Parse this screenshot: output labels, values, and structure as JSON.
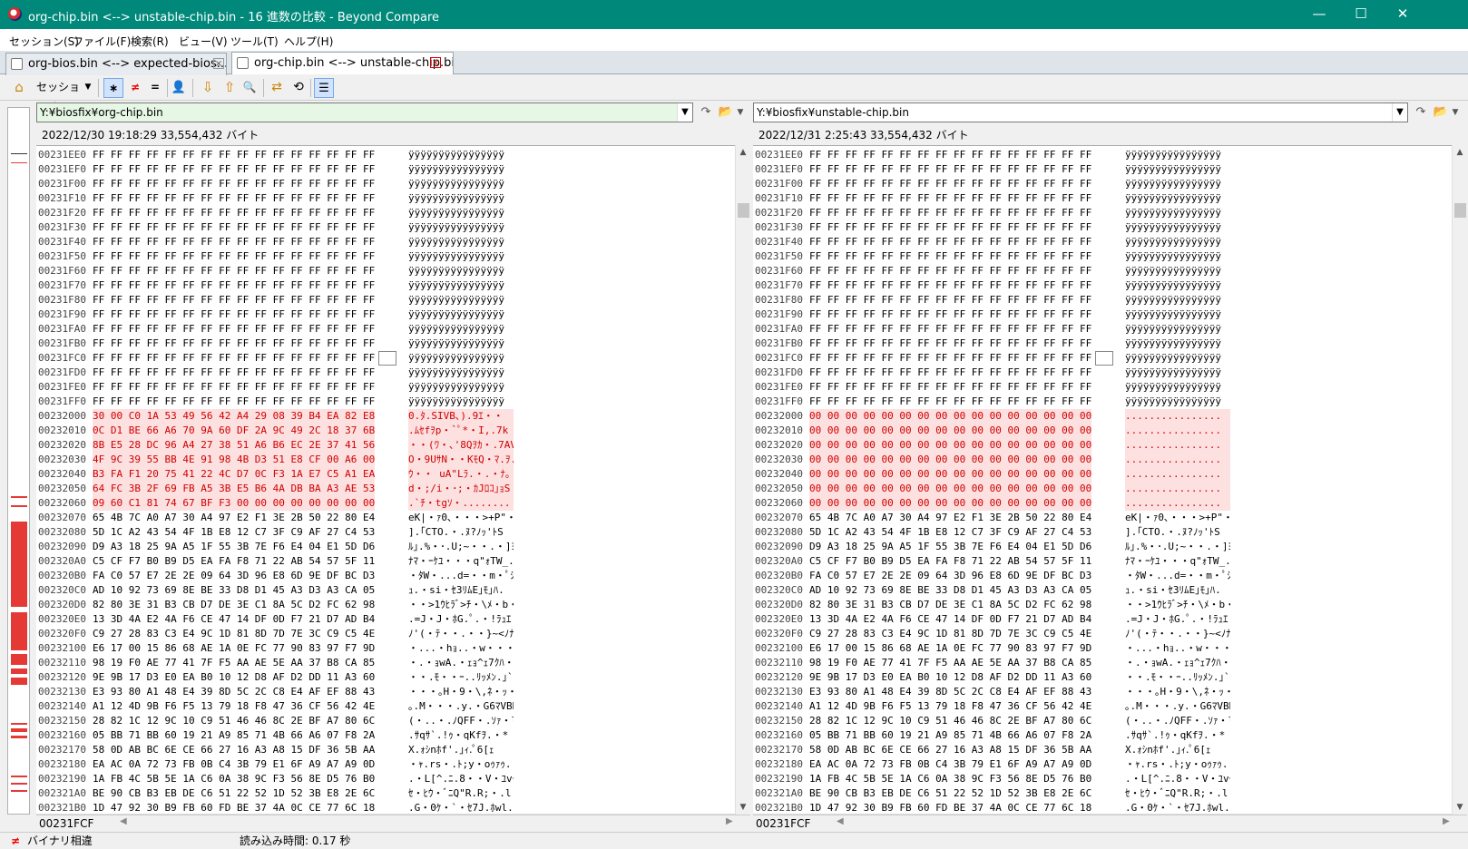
{
  "window": {
    "title": "org-chip.bin <--> unstable-chip.bin - 16 進数の比較 - Beyond Compare",
    "minimize": "—",
    "maximize": "☐",
    "close": "✕"
  },
  "menu": [
    "セッション(S)",
    "ファイル(F)",
    "検索(R)",
    "ビュー(V)",
    "ツール(T)",
    "ヘルプ(H)"
  ],
  "tabs": [
    {
      "label": "org-bios.bin <--> expected-bios...."
    },
    {
      "label": "org-chip.bin <--> unstable-chip.bin"
    }
  ],
  "toolbar": {
    "home_icon": "home-icon",
    "session_label": "セッション",
    "all_icon": "asterisk-icon",
    "all_glyph": "∗",
    "diffs_glyph": "≠",
    "same_glyph": "=",
    "person_glyph": "👤",
    "next_glyph": "⇩",
    "prev_glyph": "⇧",
    "find_glyph": "🔍",
    "swap_glyph": "⇄",
    "ref_glyph": "⟲",
    "options_glyph": "☰"
  },
  "left": {
    "path": "Y:¥biosfix¥org-chip.bin",
    "info": "2022/12/30 19:18:29   33,554,432 バイト",
    "position": "00231FCF"
  },
  "right": {
    "path": "Y:¥biosfix¥unstable-chip.bin",
    "info": "2022/12/31 2:25:43   33,554,432 バイト",
    "position": "00231FCF"
  },
  "rows": [
    {
      "off": "00231EE0",
      "lhex": "FF FF FF FF FF FF FF FF FF FF FF FF FF FF FF FF",
      "ltxt": "ÿÿÿÿÿÿÿÿÿÿÿÿÿÿÿÿ",
      "rhex": "FF FF FF FF FF FF FF FF FF FF FF FF FF FF FF FF",
      "rtxt": "ÿÿÿÿÿÿÿÿÿÿÿÿÿÿÿÿ",
      "diff": false
    },
    {
      "off": "00231EF0",
      "lhex": "FF FF FF FF FF FF FF FF FF FF FF FF FF FF FF FF",
      "ltxt": "ÿÿÿÿÿÿÿÿÿÿÿÿÿÿÿÿ",
      "rhex": "FF FF FF FF FF FF FF FF FF FF FF FF FF FF FF FF",
      "rtxt": "ÿÿÿÿÿÿÿÿÿÿÿÿÿÿÿÿ",
      "diff": false
    },
    {
      "off": "00231F00",
      "lhex": "FF FF FF FF FF FF FF FF FF FF FF FF FF FF FF FF",
      "ltxt": "ÿÿÿÿÿÿÿÿÿÿÿÿÿÿÿÿ",
      "rhex": "FF FF FF FF FF FF FF FF FF FF FF FF FF FF FF FF",
      "rtxt": "ÿÿÿÿÿÿÿÿÿÿÿÿÿÿÿÿ",
      "diff": false
    },
    {
      "off": "00231F10",
      "lhex": "FF FF FF FF FF FF FF FF FF FF FF FF FF FF FF FF",
      "ltxt": "ÿÿÿÿÿÿÿÿÿÿÿÿÿÿÿÿ",
      "rhex": "FF FF FF FF FF FF FF FF FF FF FF FF FF FF FF FF",
      "rtxt": "ÿÿÿÿÿÿÿÿÿÿÿÿÿÿÿÿ",
      "diff": false
    },
    {
      "off": "00231F20",
      "lhex": "FF FF FF FF FF FF FF FF FF FF FF FF FF FF FF FF",
      "ltxt": "ÿÿÿÿÿÿÿÿÿÿÿÿÿÿÿÿ",
      "rhex": "FF FF FF FF FF FF FF FF FF FF FF FF FF FF FF FF",
      "rtxt": "ÿÿÿÿÿÿÿÿÿÿÿÿÿÿÿÿ",
      "diff": false
    },
    {
      "off": "00231F30",
      "lhex": "FF FF FF FF FF FF FF FF FF FF FF FF FF FF FF FF",
      "ltxt": "ÿÿÿÿÿÿÿÿÿÿÿÿÿÿÿÿ",
      "rhex": "FF FF FF FF FF FF FF FF FF FF FF FF FF FF FF FF",
      "rtxt": "ÿÿÿÿÿÿÿÿÿÿÿÿÿÿÿÿ",
      "diff": false
    },
    {
      "off": "00231F40",
      "lhex": "FF FF FF FF FF FF FF FF FF FF FF FF FF FF FF FF",
      "ltxt": "ÿÿÿÿÿÿÿÿÿÿÿÿÿÿÿÿ",
      "rhex": "FF FF FF FF FF FF FF FF FF FF FF FF FF FF FF FF",
      "rtxt": "ÿÿÿÿÿÿÿÿÿÿÿÿÿÿÿÿ",
      "diff": false
    },
    {
      "off": "00231F50",
      "lhex": "FF FF FF FF FF FF FF FF FF FF FF FF FF FF FF FF",
      "ltxt": "ÿÿÿÿÿÿÿÿÿÿÿÿÿÿÿÿ",
      "rhex": "FF FF FF FF FF FF FF FF FF FF FF FF FF FF FF FF",
      "rtxt": "ÿÿÿÿÿÿÿÿÿÿÿÿÿÿÿÿ",
      "diff": false
    },
    {
      "off": "00231F60",
      "lhex": "FF FF FF FF FF FF FF FF FF FF FF FF FF FF FF FF",
      "ltxt": "ÿÿÿÿÿÿÿÿÿÿÿÿÿÿÿÿ",
      "rhex": "FF FF FF FF FF FF FF FF FF FF FF FF FF FF FF FF",
      "rtxt": "ÿÿÿÿÿÿÿÿÿÿÿÿÿÿÿÿ",
      "diff": false
    },
    {
      "off": "00231F70",
      "lhex": "FF FF FF FF FF FF FF FF FF FF FF FF FF FF FF FF",
      "ltxt": "ÿÿÿÿÿÿÿÿÿÿÿÿÿÿÿÿ",
      "rhex": "FF FF FF FF FF FF FF FF FF FF FF FF FF FF FF FF",
      "rtxt": "ÿÿÿÿÿÿÿÿÿÿÿÿÿÿÿÿ",
      "diff": false
    },
    {
      "off": "00231F80",
      "lhex": "FF FF FF FF FF FF FF FF FF FF FF FF FF FF FF FF",
      "ltxt": "ÿÿÿÿÿÿÿÿÿÿÿÿÿÿÿÿ",
      "rhex": "FF FF FF FF FF FF FF FF FF FF FF FF FF FF FF FF",
      "rtxt": "ÿÿÿÿÿÿÿÿÿÿÿÿÿÿÿÿ",
      "diff": false
    },
    {
      "off": "00231F90",
      "lhex": "FF FF FF FF FF FF FF FF FF FF FF FF FF FF FF FF",
      "ltxt": "ÿÿÿÿÿÿÿÿÿÿÿÿÿÿÿÿ",
      "rhex": "FF FF FF FF FF FF FF FF FF FF FF FF FF FF FF FF",
      "rtxt": "ÿÿÿÿÿÿÿÿÿÿÿÿÿÿÿÿ",
      "diff": false
    },
    {
      "off": "00231FA0",
      "lhex": "FF FF FF FF FF FF FF FF FF FF FF FF FF FF FF FF",
      "ltxt": "ÿÿÿÿÿÿÿÿÿÿÿÿÿÿÿÿ",
      "rhex": "FF FF FF FF FF FF FF FF FF FF FF FF FF FF FF FF",
      "rtxt": "ÿÿÿÿÿÿÿÿÿÿÿÿÿÿÿÿ",
      "diff": false
    },
    {
      "off": "00231FB0",
      "lhex": "FF FF FF FF FF FF FF FF FF FF FF FF FF FF FF FF",
      "ltxt": "ÿÿÿÿÿÿÿÿÿÿÿÿÿÿÿÿ",
      "rhex": "FF FF FF FF FF FF FF FF FF FF FF FF FF FF FF FF",
      "rtxt": "ÿÿÿÿÿÿÿÿÿÿÿÿÿÿÿÿ",
      "diff": false
    },
    {
      "off": "00231FC0",
      "lhex": "FF FF FF FF FF FF FF FF FF FF FF FF FF FF FF FF",
      "ltxt": "ÿÿÿÿÿÿÿÿÿÿÿÿÿÿÿÿ",
      "rhex": "FF FF FF FF FF FF FF FF FF FF FF FF FF FF FF FF",
      "rtxt": "ÿÿÿÿÿÿÿÿÿÿÿÿÿÿÿÿ",
      "diff": false
    },
    {
      "off": "00231FD0",
      "lhex": "FF FF FF FF FF FF FF FF FF FF FF FF FF FF FF FF",
      "ltxt": "ÿÿÿÿÿÿÿÿÿÿÿÿÿÿÿÿ",
      "rhex": "FF FF FF FF FF FF FF FF FF FF FF FF FF FF FF FF",
      "rtxt": "ÿÿÿÿÿÿÿÿÿÿÿÿÿÿÿÿ",
      "diff": false
    },
    {
      "off": "00231FE0",
      "lhex": "FF FF FF FF FF FF FF FF FF FF FF FF FF FF FF FF",
      "ltxt": "ÿÿÿÿÿÿÿÿÿÿÿÿÿÿÿÿ",
      "rhex": "FF FF FF FF FF FF FF FF FF FF FF FF FF FF FF FF",
      "rtxt": "ÿÿÿÿÿÿÿÿÿÿÿÿÿÿÿÿ",
      "diff": false
    },
    {
      "off": "00231FF0",
      "lhex": "FF FF FF FF FF FF FF FF FF FF FF FF FF FF FF FF",
      "ltxt": "ÿÿÿÿÿÿÿÿÿÿÿÿÿÿÿÿ",
      "rhex": "FF FF FF FF FF FF FF FF FF FF FF FF FF FF FF FF",
      "rtxt": "ÿÿÿÿÿÿÿÿÿÿÿÿÿÿÿÿ",
      "diff": false
    },
    {
      "off": "00232000",
      "lhex": "30 00 C0 1A 53 49 56 42 A4 29 08 39 B4 EA 82 E8",
      "ltxt": "0.ﾀ.SIVB､).9ｴ・・",
      "rhex": "00 00 00 00 00 00 00 00 00 00 00 00 00 00 00 00",
      "rtxt": "................",
      "diff": true
    },
    {
      "off": "00232010",
      "lhex": "0C D1 BE 66 A6 70 9A 60 DF 2A 9C 49 2C 18 37 6B",
      "ltxt": ".ﾑｾfｦp・`ﾟ*・I,.7k",
      "rhex": "00 00 00 00 00 00 00 00 00 00 00 00 00 00 00 00",
      "rtxt": "................",
      "diff": true
    },
    {
      "off": "00232020",
      "lhex": "8B E5 28 DC 96 A4 27 38 51 A6 B6 EC 2E 37 41 56",
      "ltxt": "・・(ﾜ・､'8Qｦｶ・.7AV",
      "rhex": "00 00 00 00 00 00 00 00 00 00 00 00 00 00 00 00",
      "rtxt": "................",
      "diff": true
    },
    {
      "off": "00232030",
      "lhex": "4F 9C 39 55 BB 4E 91 98 4B D3 51 E8 CF 00 A6 00",
      "ltxt": "O・9UｻN・・KﾓQ・ﾏ.ｦ.",
      "rhex": "00 00 00 00 00 00 00 00 00 00 00 00 00 00 00 00",
      "rtxt": "................",
      "diff": true
    },
    {
      "off": "00232040",
      "lhex": "B3 FA F1 20 75 41 22 4C D7 0C F3 1A E7 C5 A1 EA",
      "ltxt": "ｳ・・ uA\"Lﾗ.・.・ﾅ｡・",
      "rhex": "00 00 00 00 00 00 00 00 00 00 00 00 00 00 00 00",
      "rtxt": "................",
      "diff": true
    },
    {
      "off": "00232050",
      "lhex": "64 FC 3B 2F 69 FB A5 3B E5 B6 4A DB BA A3 AE 53",
      "ltxt": "d・;/i・･;・ｶJﾛｺ｣ｮS",
      "rhex": "00 00 00 00 00 00 00 00 00 00 00 00 00 00 00 00",
      "rtxt": "................",
      "diff": true
    },
    {
      "off": "00232060",
      "lhex": "09 60 C1 81 74 67 BF F3 00 00 00 00 00 00 00 00",
      "ltxt": ".`ﾁ・tgｿ・........",
      "rhex": "00 00 00 00 00 00 00 00 00 00 00 00 00 00 00 00",
      "rtxt": "................",
      "diff": true
    },
    {
      "off": "00232070",
      "lhex": "65 4B 7C A0 A7 30 A4 97 E2 F1 3E 2B 50 22 80 E4",
      "ltxt": "eK|・ｧ0､・・・>+P\"・・",
      "rhex": "65 4B 7C A0 A7 30 A4 97 E2 F1 3E 2B 50 22 80 E4",
      "rtxt": "eK|・ｧ0､・・・>+P\"・・",
      "diff": false
    },
    {
      "off": "00232080",
      "lhex": "5D 1C A2 43 54 4F 1B E8 12 C7 3F C9 AF 27 C4 53",
      "ltxt": "].｢CTO.・.ﾇ?ﾉｯ'ﾄS",
      "rhex": "5D 1C A2 43 54 4F 1B E8 12 C7 3F C9 AF 27 C4 53",
      "rtxt": "].｢CTO.・.ﾇ?ﾉｯ'ﾄS",
      "diff": false
    },
    {
      "off": "00232090",
      "lhex": "D9 A3 18 25 9A A5 1F 55 3B 7E F6 E4 04 E1 5D D6",
      "ltxt": "ﾙ｣.%・･.U;~・・.・]ﾖ",
      "rhex": "D9 A3 18 25 9A A5 1F 55 3B 7E F6 E4 04 E1 5D D6",
      "rtxt": "ﾙ｣.%・･.U;~・・.・]ﾖ",
      "diff": false
    },
    {
      "off": "002320A0",
      "lhex": "C5 CF F7 B0 B9 D5 EA FA F8 71 22 AB 54 57 5F 11",
      "ltxt": "ﾅﾏ・ｰｹﾕ・・・q\"ｫTW_.",
      "rhex": "C5 CF F7 B0 B9 D5 EA FA F8 71 22 AB 54 57 5F 11",
      "rtxt": "ﾅﾏ・ｰｹﾕ・・・q\"ｫTW_.",
      "diff": false
    },
    {
      "off": "002320B0",
      "lhex": "FA C0 57 E7 2E 2E 09 64 3D 96 E8 6D 9E DF BC D3",
      "ltxt": "・ﾀW・...d=・・m・ﾟｼﾓ",
      "rhex": "FA C0 57 E7 2E 2E 09 64 3D 96 E8 6D 9E DF BC D3",
      "rtxt": "・ﾀW・...d=・・m・ﾟｼﾓ",
      "diff": false
    },
    {
      "off": "002320C0",
      "lhex": "AD 10 92 73 69 8E BE 33 D8 D1 45 A3 D3 A3 CA 05",
      "ltxt": "ｭ.・si・ｾ3ﾘﾑE｣ﾓ｣ﾊ.",
      "rhex": "AD 10 92 73 69 8E BE 33 D8 D1 45 A3 D3 A3 CA 05",
      "rtxt": "ｭ.・si・ｾ3ﾘﾑE｣ﾓ｣ﾊ.",
      "diff": false
    },
    {
      "off": "002320D0",
      "lhex": "82 80 3E 31 B3 CB D7 DE 3E C1 8A 5C D2 FC 62 98",
      "ltxt": "・・>1ｳﾋﾗﾞ>ﾁ・\\ﾒ・b・",
      "rhex": "82 80 3E 31 B3 CB D7 DE 3E C1 8A 5C D2 FC 62 98",
      "rtxt": "・・>1ｳﾋﾗﾞ>ﾁ・\\ﾒ・b・",
      "diff": false
    },
    {
      "off": "002320E0",
      "lhex": "13 3D 4A E2 4A F6 CE 47 14 DF 0D F7 21 D7 AD B4",
      "ltxt": ".=J・J・ﾎG.ﾟ.・!ﾗｭｴ",
      "rhex": "13 3D 4A E2 4A F6 CE 47 14 DF 0D F7 21 D7 AD B4",
      "rtxt": ".=J・J・ﾎG.ﾟ.・!ﾗｭｴ",
      "diff": false
    },
    {
      "off": "002320F0",
      "lhex": "C9 27 28 83 C3 E4 9C 1D 81 8D 7D 7E 3C C9 C5 4E",
      "ltxt": "ﾉ'(・ﾃ・・.・・}~<ﾉﾅN",
      "rhex": "C9 27 28 83 C3 E4 9C 1D 81 8D 7D 7E 3C C9 C5 4E",
      "rtxt": "ﾉ'(・ﾃ・・.・・}~<ﾉﾅN",
      "diff": false
    },
    {
      "off": "00232100",
      "lhex": "E6 17 00 15 86 68 AE 1A 0E FC 77 90 83 97 F7 9D",
      "ltxt": "・...・hｮ..・w・・・・・",
      "rhex": "E6 17 00 15 86 68 AE 1A 0E FC 77 90 83 97 F7 9D",
      "rtxt": "・...・hｮ..・w・・・・・",
      "diff": false
    },
    {
      "off": "00232110",
      "lhex": "98 19 F0 AE 77 41 7F F5 AA AE 5E AA 37 B8 CA 85",
      "ltxt": "・.・ｮwA.・ｪｮ^ｪ7ｸﾊ・",
      "rhex": "98 19 F0 AE 77 41 7F F5 AA AE 5E AA 37 B8 CA 85",
      "rtxt": "・.・ｮwA.・ｪｮ^ｪ7ｸﾊ・",
      "diff": false
    },
    {
      "off": "00232120",
      "lhex": "9E 9B 17 D3 E0 EA B0 10 12 D8 AF D2 DD 11 A3 60",
      "ltxt": "・・.ﾓ・・ｰ..ﾘｯﾒﾝ.｣`",
      "rhex": "9E 9B 17 D3 E0 EA B0 10 12 D8 AF D2 DD 11 A3 60",
      "rtxt": "・・.ﾓ・・ｰ..ﾘｯﾒﾝ.｣`",
      "diff": false
    },
    {
      "off": "00232130",
      "lhex": "E3 93 80 A1 48 E4 39 8D 5C 2C C8 E4 AF EF 88 43",
      "ltxt": "・・・｡H・9・\\,ﾈ・ｯ・・C",
      "rhex": "E3 93 80 A1 48 E4 39 8D 5C 2C C8 E4 AF EF 88 43",
      "rtxt": "・・・｡H・9・\\,ﾈ・ｯ・・C",
      "diff": false
    },
    {
      "off": "00232140",
      "lhex": "A1 12 4D 9B F6 F5 13 79 18 F8 47 36 CF 56 42 4E",
      "ltxt": "｡.M・・・.y.・G6ﾏVBN",
      "rhex": "A1 12 4D 9B F6 F5 13 79 18 F8 47 36 CF 56 42 4E",
      "rtxt": "｡.M・・・.y.・G6ﾏVBN",
      "diff": false
    },
    {
      "off": "00232150",
      "lhex": "28 82 1C 12 9C 10 C9 51 46 46 8C 2E BF A7 80 6C",
      "ltxt": "(・..・.ﾉQFF・.ｿｧ・l",
      "rhex": "28 82 1C 12 9C 10 C9 51 46 46 8C 2E BF A7 80 6C",
      "rtxt": "(・..・.ﾉQFF・.ｿｧ・l",
      "diff": false
    },
    {
      "off": "00232160",
      "lhex": "05 BB 71 BB 60 19 21 A9 85 71 4B 66 A6 07 F8 2A",
      "ltxt": ".ｻqｻ`.!ｩ・qKfｦ.・*",
      "rhex": "05 BB 71 BB 60 19 21 A9 85 71 4B 66 A6 07 F8 2A",
      "rtxt": ".ｻqｻ`.!ｩ・qKfｦ.・*",
      "diff": false
    },
    {
      "off": "00232170",
      "lhex": "58 0D AB BC 6E CE 66 27 16 A3 A8 15 DF 36 5B AA",
      "ltxt": "X.ｫｼnﾎf'.｣ｨ.ﾟ6[ｪ",
      "rhex": "58 0D AB BC 6E CE 66 27 16 A3 A8 15 DF 36 5B AA",
      "rtxt": "X.ｫｼnﾎf'.｣ｨ.ﾟ6[ｪ",
      "diff": false
    },
    {
      "off": "00232180",
      "lhex": "EA AC 0A 72 73 FB 0B C4 3B 79 E1 6F A9 A7 A9 0D",
      "ltxt": "・ｬ.rs・.ﾄ;y・oｩｧｩ.",
      "rhex": "EA AC 0A 72 73 FB 0B C4 3B 79 E1 6F A9 A7 A9 0D",
      "rtxt": "・ｬ.rs・.ﾄ;y・oｩｧｩ.",
      "diff": false
    },
    {
      "off": "00232190",
      "lhex": "1A FB 4C 5B 5E 1A C6 0A 38 9C F3 56 8E D5 76 B0",
      "ltxt": ".・L[^.ﾆ.8・・V・ﾕvｰ",
      "rhex": "1A FB 4C 5B 5E 1A C6 0A 38 9C F3 56 8E D5 76 B0",
      "rtxt": ".・L[^.ﾆ.8・・V・ﾕvｰ",
      "diff": false
    },
    {
      "off": "002321A0",
      "lhex": "BE 90 CB B3 EB DE C6 51 22 52 1D 52 3B E8 2E 6C",
      "ltxt": "ｾ・ﾋｳ・ﾞﾆQ\"R.R;・.l",
      "rhex": "BE 90 CB B3 EB DE C6 51 22 52 1D 52 3B E8 2E 6C",
      "rtxt": "ｾ・ﾋｳ・ﾞﾆQ\"R.R;・.l",
      "diff": false
    },
    {
      "off": "002321B0",
      "lhex": "1D 47 92 30 B9 FB 60 FD BE 37 4A 0C CE 77 6C 18",
      "ltxt": ".G・0ｹ・`・ｾ7J.ﾎwl.",
      "rhex": "1D 47 92 30 B9 FB 60 FD BE 37 4A 0C CE 77 6C 18",
      "rtxt": ".G・0ｹ・`・ｾ7J.ﾎwl.",
      "diff": false
    }
  ],
  "status": {
    "icon": "≠",
    "diff_text": "バイナリ相違",
    "load_time": "読み込み時間: 0.17 秒"
  }
}
